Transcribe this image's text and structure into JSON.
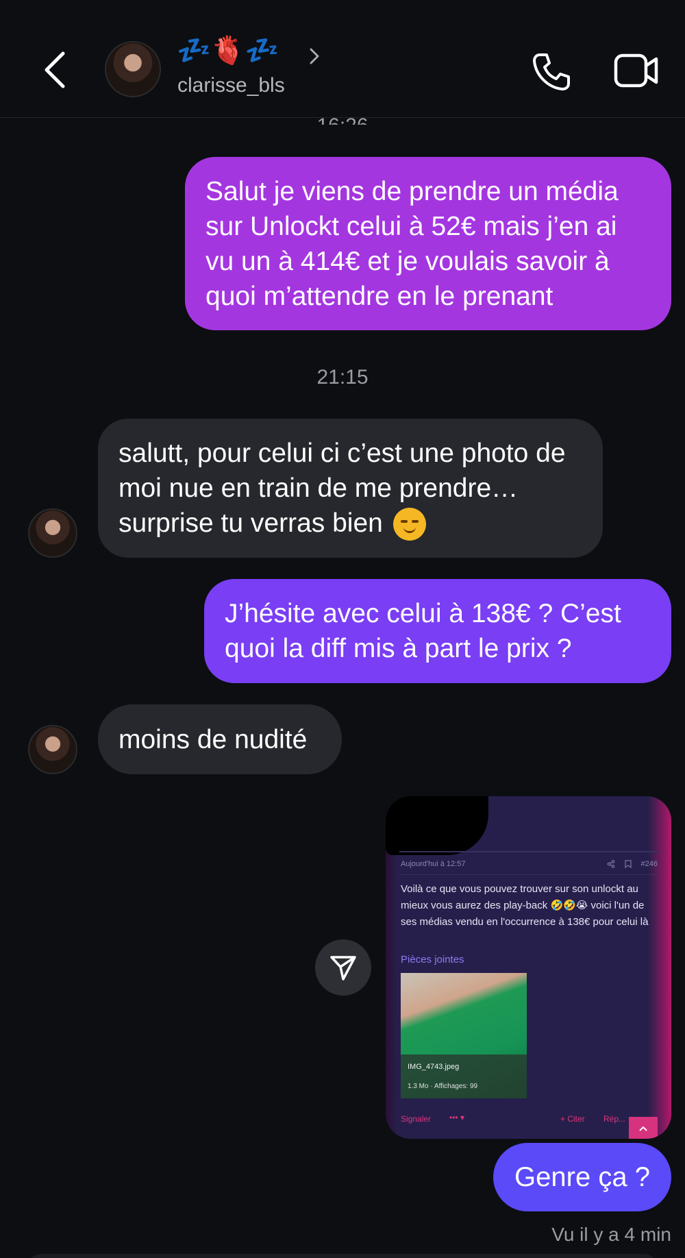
{
  "header": {
    "display_name": "💤🫀💤",
    "username": "clarisse_bls"
  },
  "timestamps": {
    "top_partial": "16:26",
    "middle": "21:15"
  },
  "messages": {
    "outgoing_1": "Salut je viens de prendre un média sur Unlockt celui à 52€ mais j’en ai vu un à 414€ et je voulais savoir à quoi m’attendre en le prenant",
    "incoming_1": "salutt, pour celui ci c’est une photo de moi nue en train de me prendre… surprise tu verras bien",
    "outgoing_2": "J’hésite avec celui à 138€ ? C’est quoi la diff mis à part le prix ?",
    "incoming_2": "moins de nudité",
    "outgoing_3": "Genre ça ?"
  },
  "shared_post": {
    "date": "Aujourd'hui à 12:57",
    "post_number": "#246",
    "text": "Voilà ce que vous pouvez trouver sur son unlockt au mieux vous aurez des play-back 🤣🤣😭 voici l'un de ses médias vendu en l'occurrence à 138€ pour celui là",
    "attachments_label": "Pièces jointes",
    "file_name": "IMG_4743.jpeg",
    "file_info": "1.3 Mo · Affichages: 99",
    "report_label": "Signaler",
    "more_label": "••• ▾",
    "quote_label": "+ Citer",
    "reply_label": "Rép..."
  },
  "status": {
    "seen": "Vu il y a 4 min"
  },
  "colors": {
    "background": "#0c0e12",
    "outgoing_1": "#a436e0",
    "outgoing_2": "#7a3ef4",
    "outgoing_3": "#5b4af8",
    "incoming": "#26282d"
  }
}
